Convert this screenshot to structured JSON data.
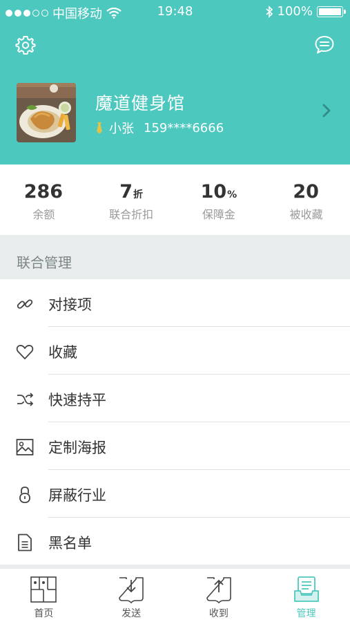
{
  "status_bar": {
    "carrier": "中国移动",
    "time": "19:48",
    "battery": "100%"
  },
  "header": {
    "gym_name": "魔道健身馆",
    "user_name": "小张",
    "phone": "159****6666"
  },
  "stats": [
    {
      "value": "286",
      "unit": "",
      "label": "余额"
    },
    {
      "value": "7",
      "unit": "折",
      "label": "联合折扣"
    },
    {
      "value": "10",
      "unit": "%",
      "label": "保障金"
    },
    {
      "value": "20",
      "unit": "",
      "label": "被收藏"
    }
  ],
  "section": {
    "title": "联合管理"
  },
  "menu": [
    {
      "label": "对接项",
      "icon": "link-icon"
    },
    {
      "label": "收藏",
      "icon": "heart-icon"
    },
    {
      "label": "快速持平",
      "icon": "shuffle-icon"
    },
    {
      "label": "定制海报",
      "icon": "image-icon"
    },
    {
      "label": "屏蔽行业",
      "icon": "lock-icon"
    },
    {
      "label": "黑名单",
      "icon": "document-icon"
    }
  ],
  "tabbar": [
    {
      "label": "首页",
      "icon": "home-grid-icon",
      "active": false
    },
    {
      "label": "发送",
      "icon": "send-icon",
      "active": false
    },
    {
      "label": "收到",
      "icon": "receive-icon",
      "active": false
    },
    {
      "label": "管理",
      "icon": "manage-icon",
      "active": true
    }
  ],
  "colors": {
    "accent": "#4dc8bf",
    "section_bg": "#e9eded",
    "text": "#333333",
    "muted": "#9a9a9a"
  }
}
